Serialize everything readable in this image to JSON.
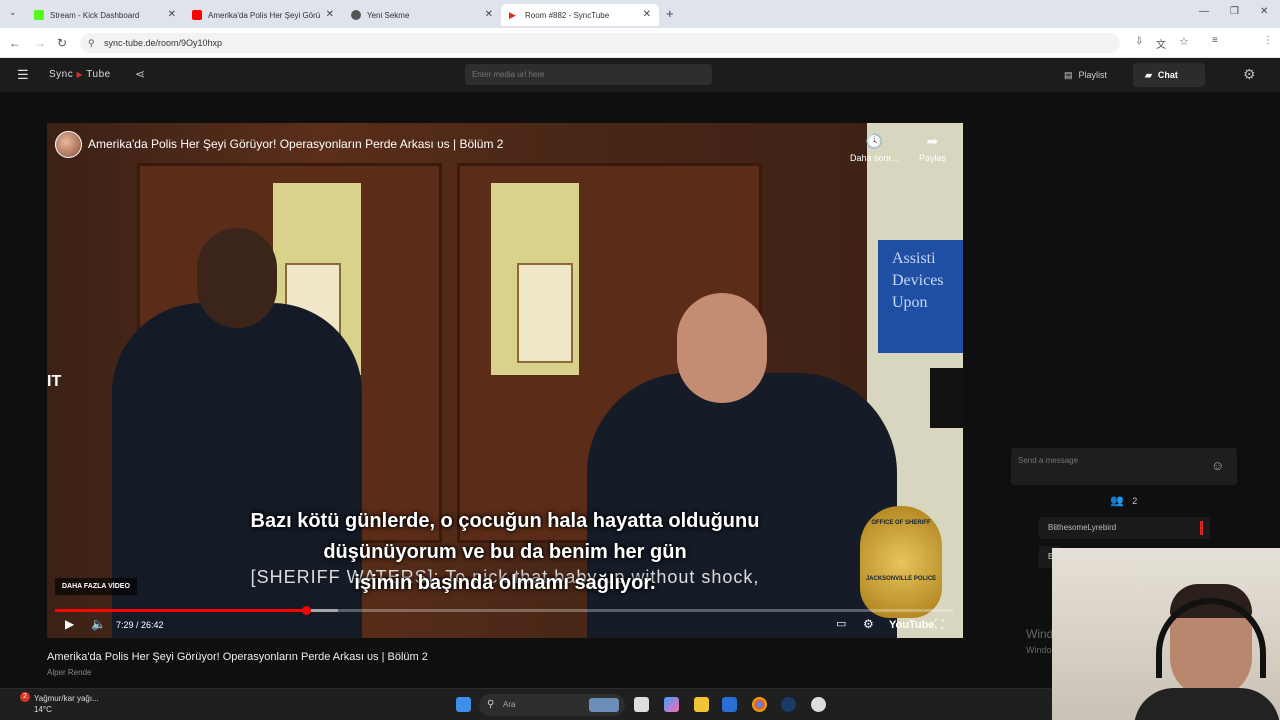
{
  "browser": {
    "tabs": [
      {
        "label": "Stream - Kick Dashboard",
        "color": "#53fc18"
      },
      {
        "label": "Amerika'da Polis Her Şeyi Görü",
        "color": "#ff0000"
      },
      {
        "label": "Yeni Sekme",
        "color": "#555555"
      },
      {
        "label": "Room #882 - SyncTube",
        "color": "#e02b2b"
      }
    ],
    "url": "sync-tube.de/room/9Oy10hxp"
  },
  "app": {
    "logo_left": "Sync",
    "logo_right": "Tube",
    "media_placeholder": "Enter media url here",
    "playlist_label": "Playlist",
    "chat_label": "Chat"
  },
  "video": {
    "title": "Amerika'da Polis Her Şeyi Görüyor! Operasyonların Perde Arkası ᴜs | Bölüm 2",
    "watch_later": "Daha sonr...",
    "share": "Paylaş",
    "subtitle_tr_1": "Bazı kötü günlerde, o çocuğun hala hayatta olduğunu",
    "subtitle_tr_2": "düşünüyorum ve bu da benim her gün",
    "subtitle_tr_3": "işimin başında olmamı sağlıyor.",
    "subtitle_en": "[SHERIFF WATERS]: To pick that baby up without shock,",
    "more_videos": "DAHA FAZLA VİDEO",
    "time": "7:29 / 26:42",
    "progress_fraction": 0.28,
    "buffer_fraction": 0.315,
    "youtube_label": "YouTube",
    "badge_top": "OFFICE OF SHERIFF",
    "badge_bottom": "JACKSONVILLE POLICE",
    "sign_text": "Assisti Devices Upon",
    "left_edge_text": "IT"
  },
  "below": {
    "title": "Amerika'da Polis Her Şeyi Görüyor! Operasyonların Perde Arkası ᴜs | Bölüm 2",
    "channel": "Alper Rende"
  },
  "chat": {
    "placeholder": "Send a message",
    "users_count": "2",
    "user1": "BlithesomeLyrebird",
    "user2": "E"
  },
  "watermark": {
    "line1": "Wind",
    "line2": "Windo"
  },
  "taskbar": {
    "weather_line1": "Yağmur/kar yağı...",
    "weather_line2": "14°C",
    "weather_badge": "2",
    "search_label": "Ara"
  }
}
